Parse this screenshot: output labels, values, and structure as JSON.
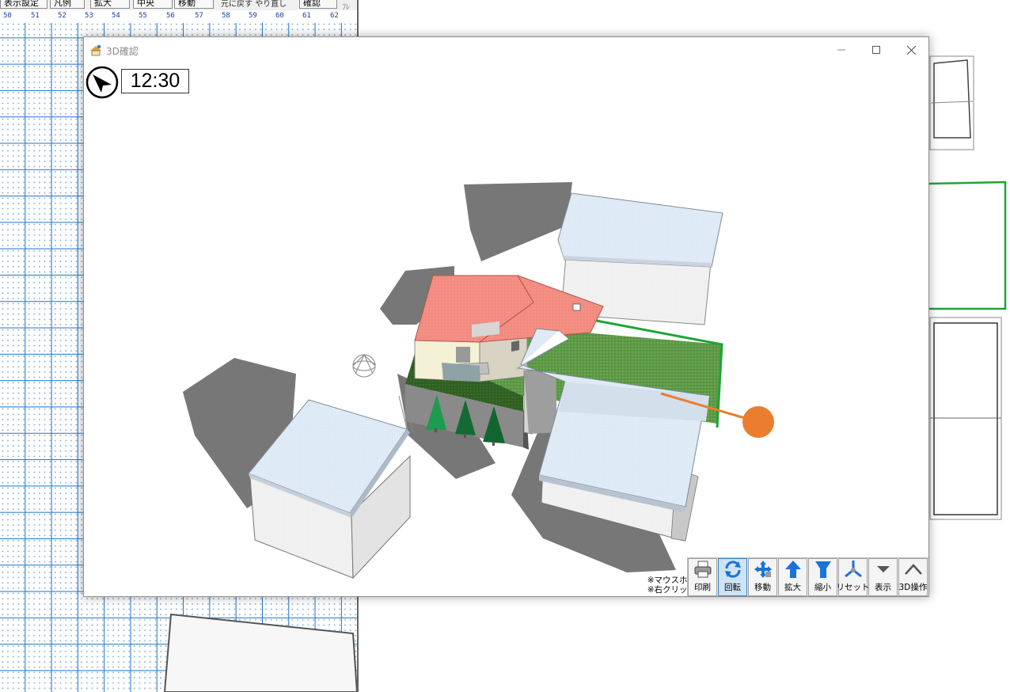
{
  "background_app": {
    "toolbar": {
      "display_settings": "表示設定",
      "legend": "凡例",
      "zoom_in": "拡大",
      "center": "中央",
      "move": "移動",
      "undo": "元に戻す",
      "redo": "やり直し",
      "rotate": "確認",
      "truncated": "ﾌﾚ"
    },
    "ruler": [
      "50",
      "51",
      "52",
      "53",
      "54",
      "55",
      "56",
      "57",
      "58",
      "59",
      "60",
      "61",
      "62"
    ]
  },
  "window": {
    "title": "3D確認",
    "minimize": "—",
    "maximize": "☐",
    "close": "✕"
  },
  "viewport": {
    "time": "12:30",
    "hint_line1": "※マウスホイール：拡大、縮小",
    "hint_line2": "※右クリック＋ドラッグ：移動"
  },
  "toolbar3d": {
    "print": "印刷",
    "rotate": "回転",
    "move": "移動",
    "zoom_in": "拡大",
    "zoom_out": "縮小",
    "reset": "リセット",
    "display": "表示",
    "operation_3d": "3D操作"
  },
  "colors": {
    "roof_red": "#f28b80",
    "lawn_green": "#6aa84f",
    "sun_orange": "#ea7e2e",
    "building_roof": "#dfeaf6",
    "active_tool": "#cfe3f7"
  },
  "icons": {
    "compass": "north-arrow-icon",
    "sun": "sun-icon",
    "app": "app-icon"
  }
}
